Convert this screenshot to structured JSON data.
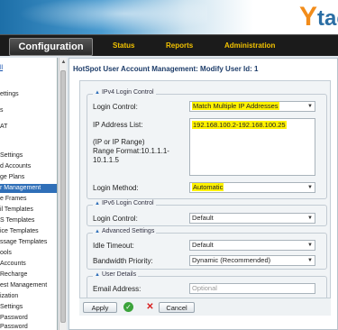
{
  "header": {
    "logo_mark": "Y",
    "logo_text": "tac"
  },
  "nav": {
    "items": [
      {
        "label": "Configuration"
      },
      {
        "label": "Status"
      },
      {
        "label": "Reports"
      },
      {
        "label": "Administration"
      }
    ]
  },
  "sidebar": {
    "items": [
      {
        "label": "ll"
      },
      {
        "label": "ettings"
      },
      {
        "label": "s"
      },
      {
        "label": "AT"
      },
      {
        "label": "Settings"
      },
      {
        "label": "d Accounts"
      },
      {
        "label": "ge Plans"
      },
      {
        "label": "r Management"
      },
      {
        "label": "e Frames"
      },
      {
        "label": "il Templates"
      },
      {
        "label": "S Templates"
      },
      {
        "label": "ice Templates"
      },
      {
        "label": "ssage Templates"
      },
      {
        "label": "ools"
      },
      {
        "label": "Accounts"
      },
      {
        "label": "Recharge"
      },
      {
        "label": "est Management"
      },
      {
        "label": "ization"
      },
      {
        "label": "Settings"
      },
      {
        "label": "Password"
      },
      {
        "label": "Password"
      }
    ]
  },
  "page": {
    "title": "HotSpot User Account Management: Modify User Id: 1"
  },
  "ipv4": {
    "legend": "IPv4 Login Control",
    "login_control_label": "Login Control:",
    "login_control_value": "Match Multiple IP Addresses",
    "ip_list_label": "IP Address List:",
    "ip_list_value": "192.168.100.2-192.168.100.25",
    "ip_hint_1": "(IP or IP Range)",
    "ip_hint_2": "Range Format:10.1.1.1-",
    "ip_hint_3": "10.1.1.5",
    "login_method_label": "Login Method:",
    "login_method_value": "Automatic"
  },
  "ipv6": {
    "legend": "IPv6 Login Control",
    "login_control_label": "Login Control:",
    "login_control_value": "Default"
  },
  "advanced": {
    "legend": "Advanced Settings",
    "idle_label": "Idle Timeout:",
    "idle_value": "Default",
    "bandwidth_label": "Bandwidth Priority:",
    "bandwidth_value": "Dynamic (Recommended)"
  },
  "user_details": {
    "legend": "User Details",
    "email_label": "Email Address:",
    "email_placeholder": "Optional"
  },
  "buttons": {
    "apply": "Apply",
    "cancel": "Cancel"
  },
  "colors": {
    "highlight": "#fff200",
    "nav_text": "#f2c200",
    "active_side": "#2f6fb8"
  }
}
